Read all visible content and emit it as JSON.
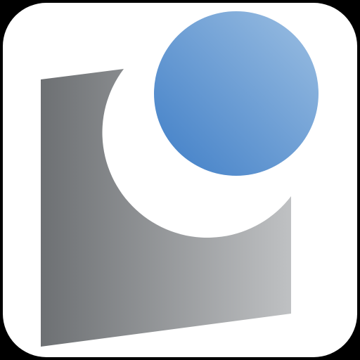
{
  "icon": {
    "name": "app-icon",
    "colors": {
      "frame": "#000000",
      "tile": "#ffffff",
      "block_dark": "#6d7073",
      "block_light": "#bfc1c3",
      "circle_dark": "#3f7ec7",
      "circle_light": "#9cbfe2"
    }
  }
}
